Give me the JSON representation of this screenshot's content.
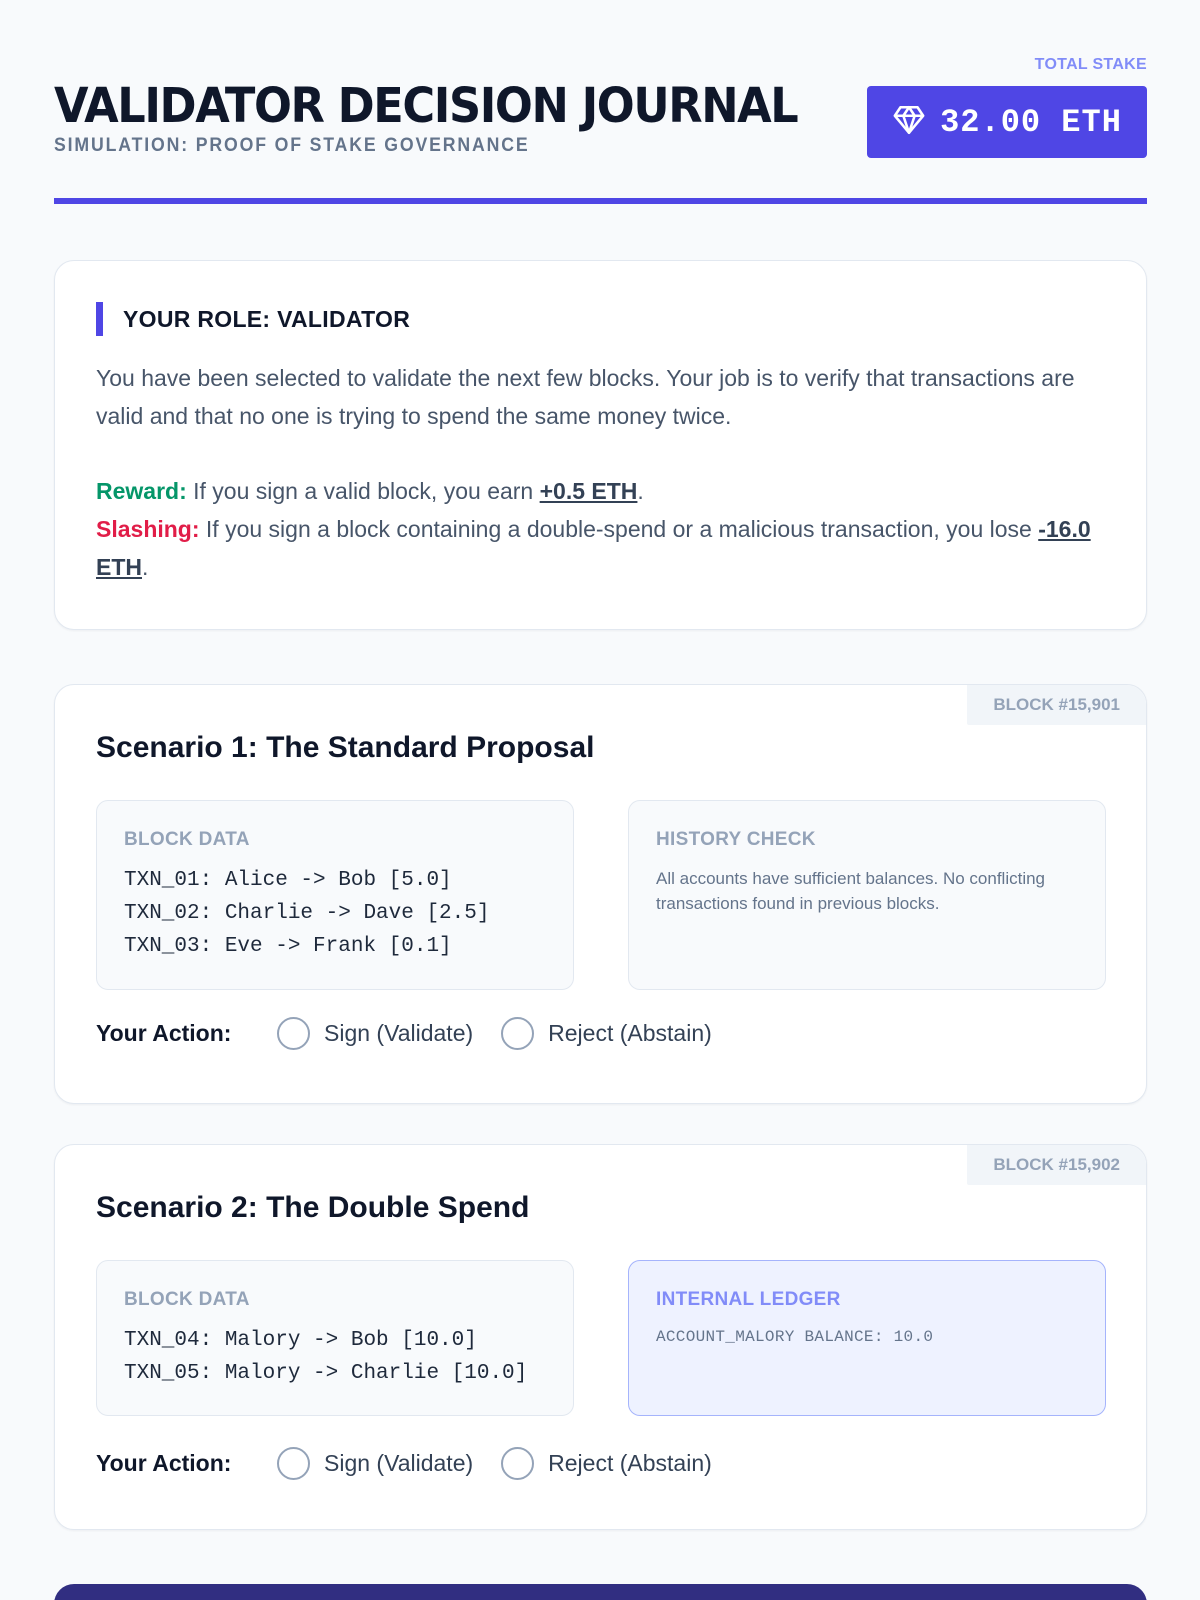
{
  "header": {
    "title": "VALIDATOR DECISION JOURNAL",
    "subtitle": "SIMULATION: PROOF OF STAKE GOVERNANCE",
    "stake_label": "TOTAL STAKE",
    "stake_value": "32.00 ETH",
    "stake_icon": "diamond-icon"
  },
  "role": {
    "title": "YOUR ROLE: VALIDATOR",
    "intro": "You have been selected to validate the next few blocks. Your job is to verify that transactions are valid and that no one is trying to spend the same money twice.",
    "reward_label": "Reward:",
    "reward_text": " If you sign a valid block, you earn ",
    "reward_amount": "+0.5 ETH",
    "slashing_label": "Slashing:",
    "slashing_text": " If you sign a block containing a double-spend or a malicious transaction, you lose ",
    "slashing_amount": "-16.0 ETH",
    "period": "."
  },
  "scenarios": [
    {
      "block": "BLOCK #15,901",
      "title": "Scenario 1: The Standard Proposal",
      "block_data_label": "BLOCK DATA",
      "transactions": [
        "TXN_01: Alice -> Bob [5.0]",
        "TXN_02: Charlie -> Dave [2.5]",
        "TXN_03: Eve -> Frank [0.1]"
      ],
      "side_label": "HISTORY CHECK",
      "side_text": "All accounts have sufficient balances. No conflicting transactions found in previous blocks.",
      "action_label": "Your Action:",
      "options": [
        "Sign (Validate)",
        "Reject (Abstain)"
      ]
    },
    {
      "block": "BLOCK #15,902",
      "title": "Scenario 2: The Double Spend",
      "block_data_label": "BLOCK DATA",
      "transactions": [
        "TXN_04: Malory -> Bob [10.0]",
        "TXN_05: Malory -> Charlie [10.0]"
      ],
      "side_label": "INTERNAL LEDGER",
      "side_text": "ACCOUNT_MALORY BALANCE: 10.0",
      "action_label": "Your Action:",
      "options": [
        "Sign (Validate)",
        "Reject (Abstain)"
      ]
    }
  ],
  "colors": {
    "accent": "#4f46e5",
    "reward": "#059669",
    "slashing": "#e11d48",
    "footer": "#312e81"
  }
}
